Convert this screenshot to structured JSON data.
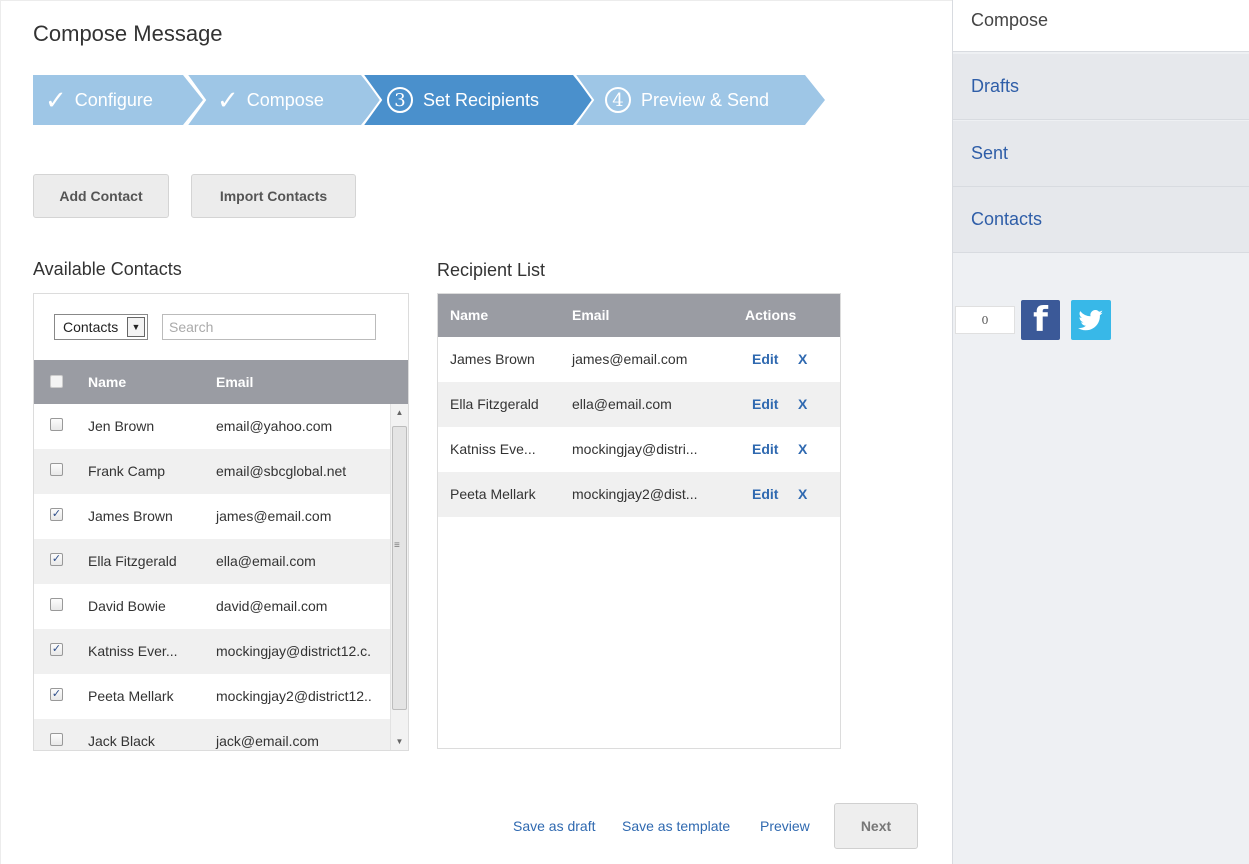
{
  "page": {
    "title": "Compose Message"
  },
  "steps": [
    {
      "label": "Configure",
      "marker": "✓",
      "status": "done"
    },
    {
      "label": "Compose",
      "marker": "✓",
      "status": "done"
    },
    {
      "label": "Set Recipients",
      "marker": "3",
      "status": "active"
    },
    {
      "label": "Preview & Send",
      "marker": "4",
      "status": "upcoming"
    }
  ],
  "toolbar": {
    "add_contact": "Add Contact",
    "import_contacts": "Import Contacts"
  },
  "available": {
    "title": "Available Contacts",
    "filter_value": "Contacts",
    "search_placeholder": "Search",
    "columns": {
      "name": "Name",
      "email": "Email"
    },
    "rows": [
      {
        "name": "Jen Brown",
        "email": "email@yahoo.com",
        "checked": false
      },
      {
        "name": "Frank Camp",
        "email": "email@sbcglobal.net",
        "checked": false
      },
      {
        "name": "James Brown",
        "email": "james@email.com",
        "checked": true
      },
      {
        "name": "Ella Fitzgerald",
        "email": "ella@email.com",
        "checked": true
      },
      {
        "name": "David Bowie",
        "email": "david@email.com",
        "checked": false
      },
      {
        "name": "Katniss Ever...",
        "email": "mockingjay@district12.c.",
        "checked": true
      },
      {
        "name": "Peeta Mellark",
        "email": "mockingjay2@district12..",
        "checked": true
      },
      {
        "name": "Jack Black",
        "email": "jack@email.com",
        "checked": false
      }
    ]
  },
  "recipients": {
    "title": "Recipient List",
    "columns": {
      "name": "Name",
      "email": "Email",
      "actions": "Actions"
    },
    "edit_label": "Edit",
    "remove_label": "X",
    "rows": [
      {
        "name": "James Brown",
        "email": "james@email.com"
      },
      {
        "name": "Ella Fitzgerald",
        "email": "ella@email.com"
      },
      {
        "name": "Katniss Eve...",
        "email": "mockingjay@distri..."
      },
      {
        "name": "Peeta Mellark",
        "email": "mockingjay2@dist..."
      }
    ]
  },
  "footer": {
    "save_draft": "Save as draft",
    "save_template": "Save as template",
    "preview": "Preview",
    "next": "Next"
  },
  "sidebar": {
    "items": [
      {
        "label": "Compose",
        "active": true
      },
      {
        "label": "Drafts",
        "active": false
      },
      {
        "label": "Sent",
        "active": false
      },
      {
        "label": "Contacts",
        "active": false
      }
    ],
    "share_count": "0"
  },
  "colors": {
    "step_done": "#9ec6e6",
    "step_active": "#4a90cc",
    "step_upcoming": "#9ec6e6",
    "link": "#2f69b0",
    "table_header": "#9a9ca3",
    "facebook": "#3b5998",
    "twitter": "#38b8e8"
  }
}
